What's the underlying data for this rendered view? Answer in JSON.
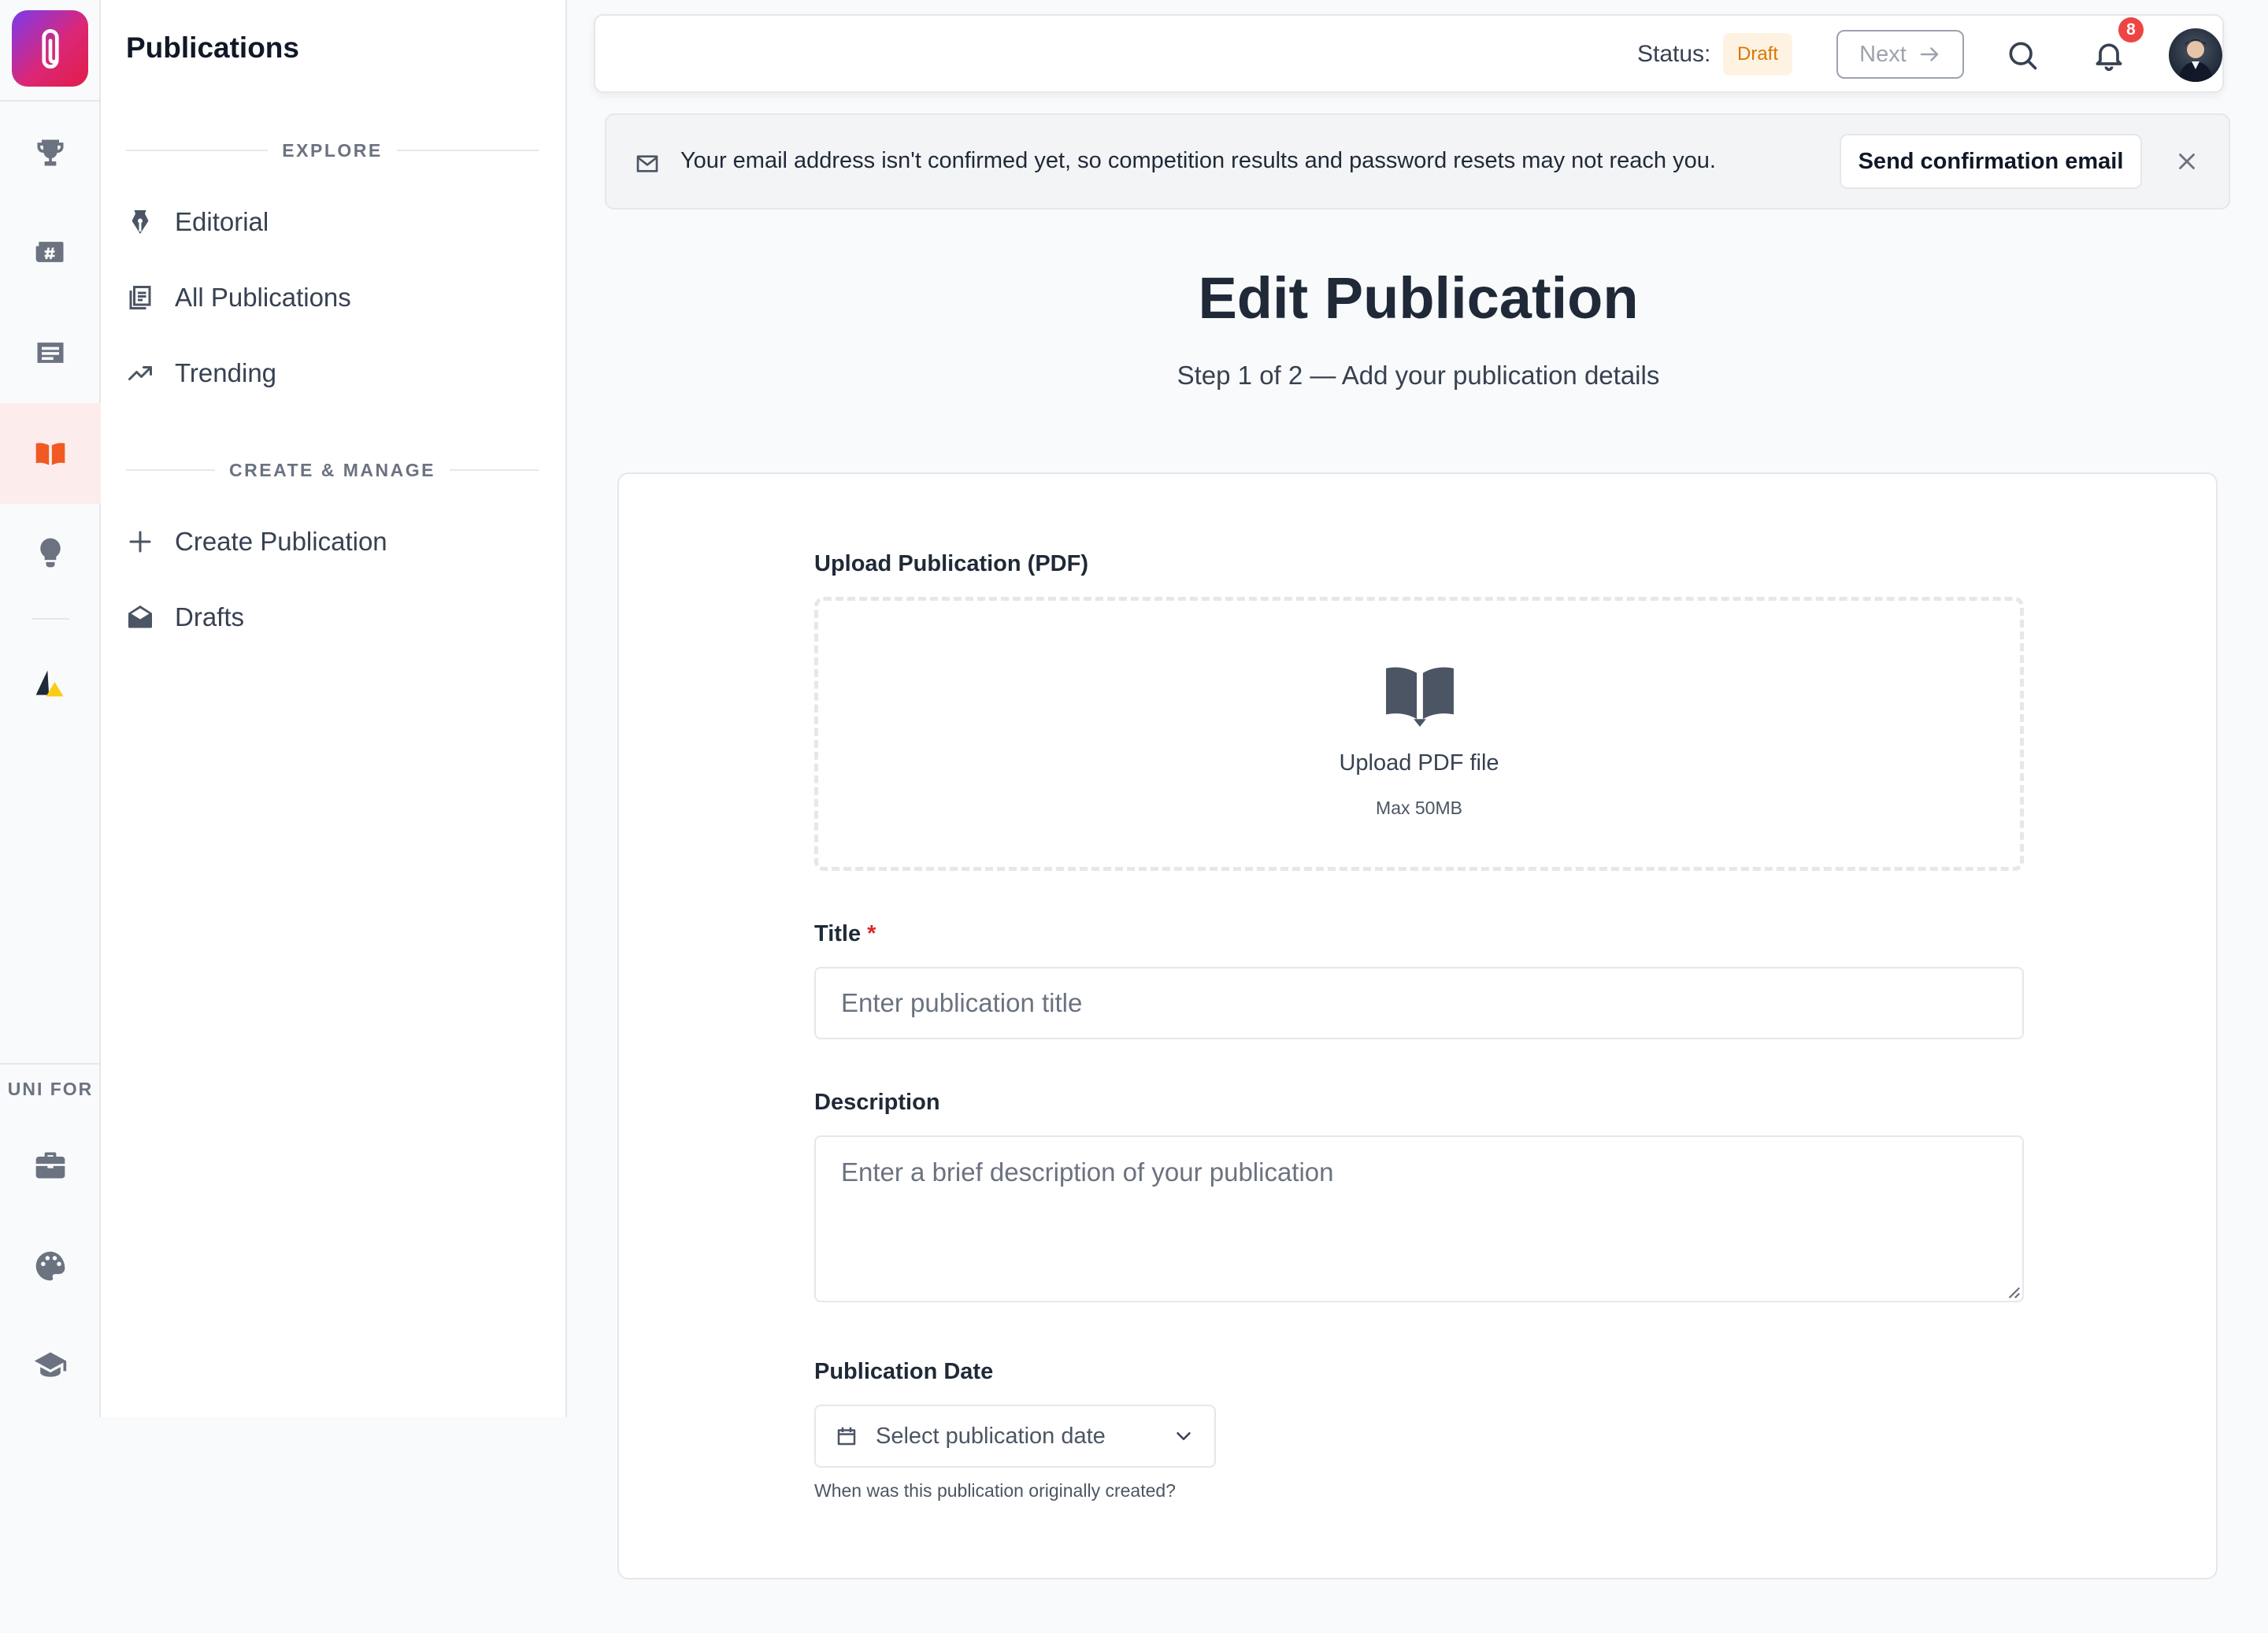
{
  "app": {
    "sidebar_title": "Publications"
  },
  "rail": {
    "items": [
      {
        "name": "trophy-icon"
      },
      {
        "name": "newspaper-hash-icon"
      },
      {
        "name": "article-list-icon"
      },
      {
        "name": "open-book-icon",
        "active": true
      },
      {
        "name": "lightbulb-icon"
      },
      {
        "name": "triangle-logo-icon"
      }
    ],
    "section_label": "UNI FOR",
    "bottom_items": [
      {
        "name": "briefcase-icon"
      },
      {
        "name": "palette-icon"
      },
      {
        "name": "graduation-cap-icon"
      }
    ]
  },
  "sidebar": {
    "explore_heading": "EXPLORE",
    "explore": [
      {
        "label": "Editorial",
        "icon": "pen-nib-icon"
      },
      {
        "label": "All Publications",
        "icon": "stacked-documents-icon"
      },
      {
        "label": "Trending",
        "icon": "trending-up-icon"
      }
    ],
    "manage_heading": "CREATE & MANAGE",
    "manage": [
      {
        "label": "Create Publication",
        "icon": "plus-icon"
      },
      {
        "label": "Drafts",
        "icon": "envelope-open-icon"
      }
    ]
  },
  "topbar": {
    "status_label": "Status:",
    "status_value": "Draft",
    "next_label": "Next",
    "notification_count": "8"
  },
  "alert": {
    "message": "Your email address isn't confirmed yet, so competition results and password resets may not reach you.",
    "action_label": "Send confirmation email"
  },
  "page": {
    "title": "Edit Publication",
    "subtitle": "Step 1 of 2 — Add your publication details"
  },
  "form": {
    "upload": {
      "label": "Upload Publication (PDF)",
      "cta": "Upload PDF file",
      "hint": "Max 50MB"
    },
    "title": {
      "label": "Title",
      "required_mark": "*",
      "placeholder": "Enter publication title",
      "value": ""
    },
    "description": {
      "label": "Description",
      "placeholder": "Enter a brief description of your publication",
      "value": ""
    },
    "date": {
      "label": "Publication Date",
      "placeholder": "Select publication date",
      "help": "When was this publication originally created?"
    }
  },
  "colors": {
    "accent": "#f05a22",
    "active_bg": "#fdecec",
    "draft_badge_bg": "#fef3e2",
    "draft_badge_text": "#d97706",
    "notification": "#ef4444",
    "required": "#dc2626"
  }
}
